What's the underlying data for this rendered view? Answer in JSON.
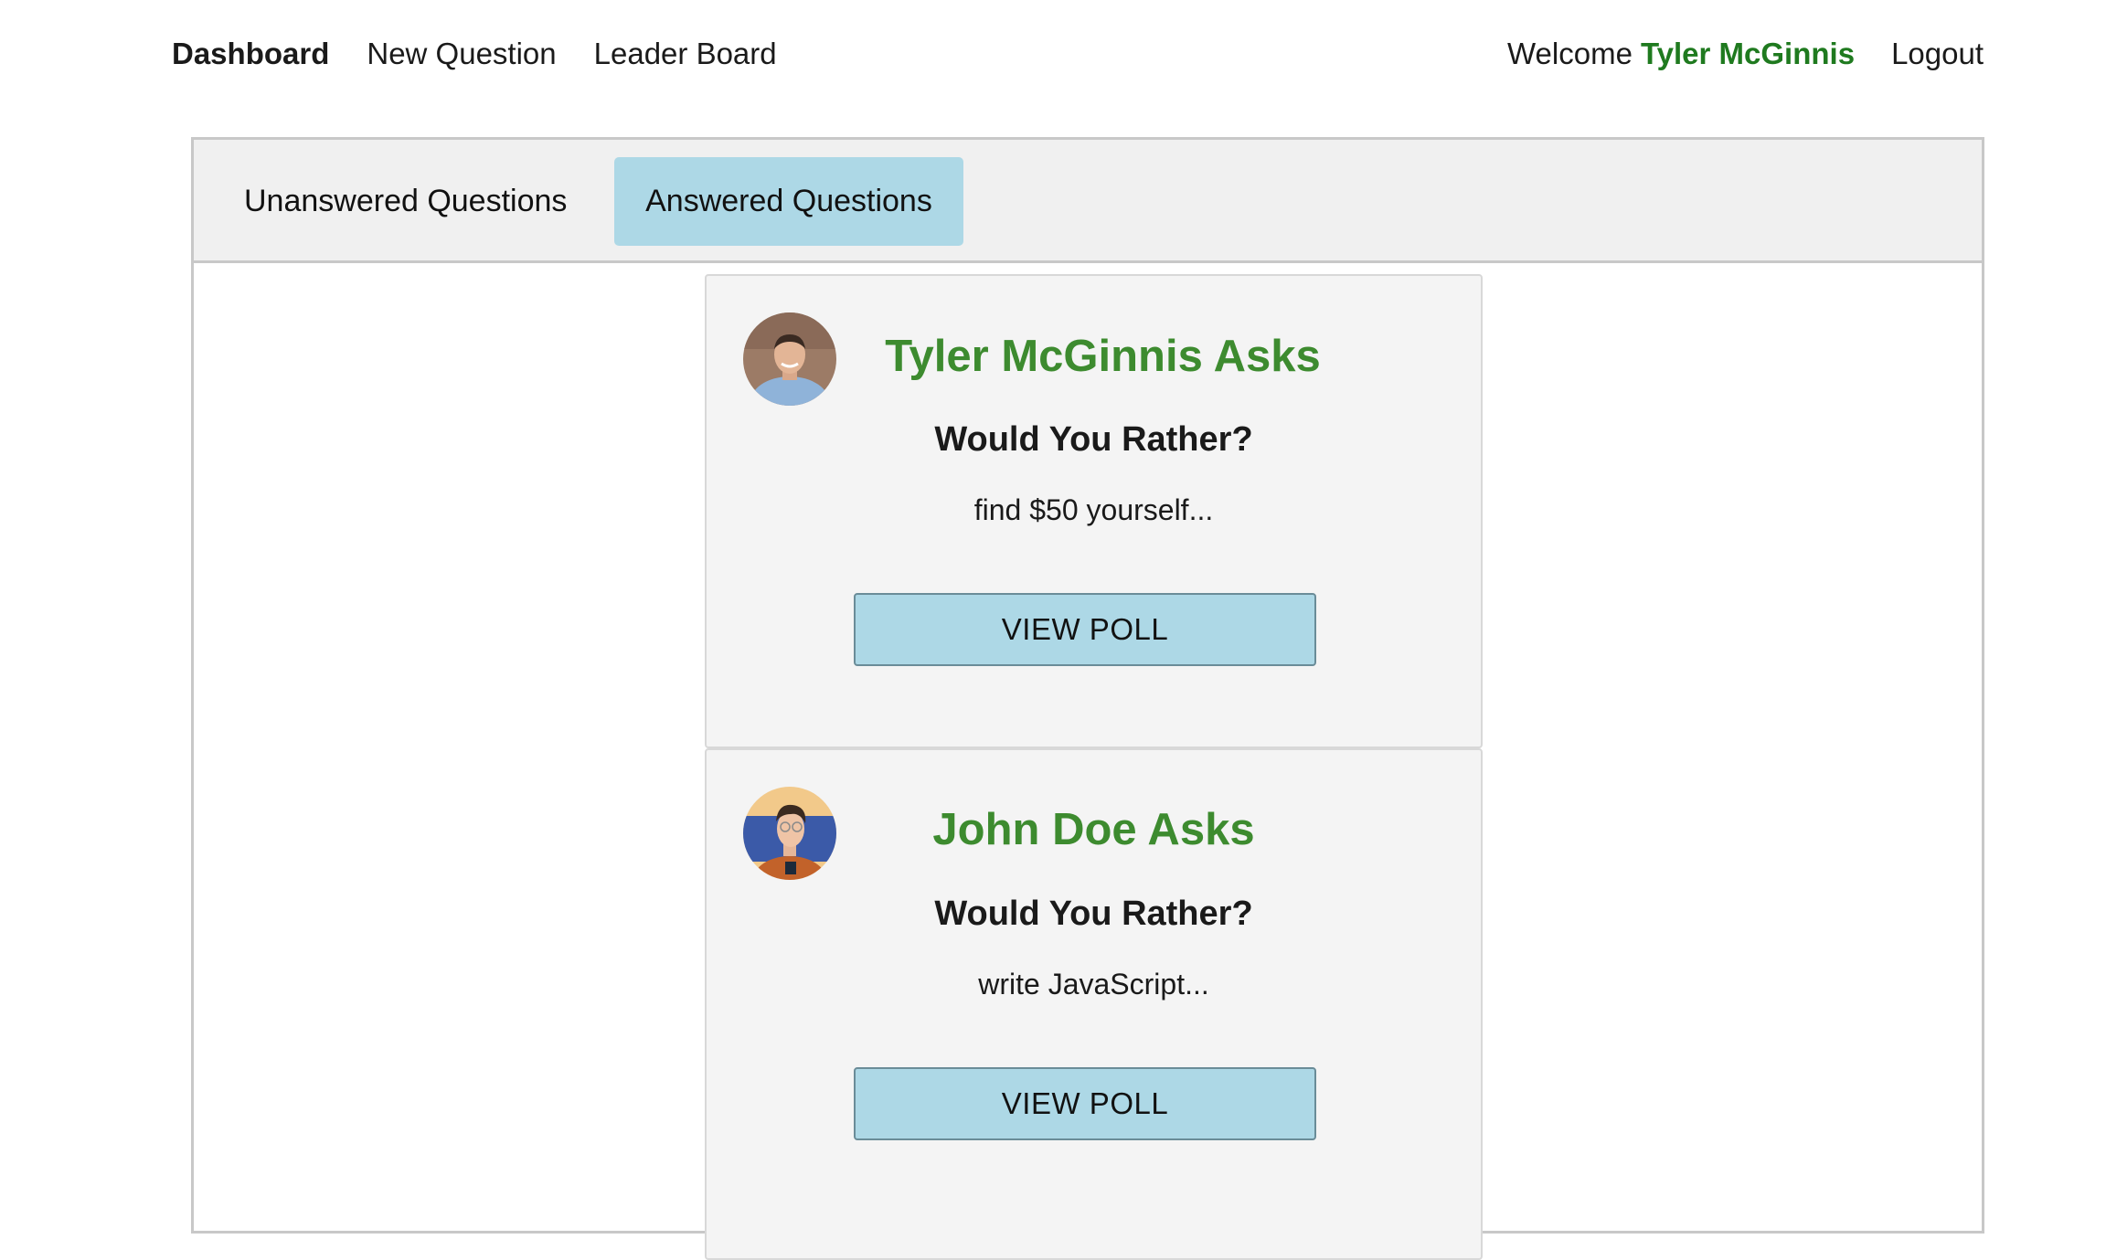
{
  "colors": {
    "accent_green": "#3d8b2f",
    "welcome_green": "#1f7a1f",
    "tab_active_bg": "#add8e6",
    "button_bg": "#add8e6"
  },
  "nav": {
    "links": [
      {
        "label": "Dashboard"
      },
      {
        "label": "New Question"
      },
      {
        "label": "Leader Board"
      }
    ],
    "welcome_prefix": "Welcome",
    "user_name": "Tyler McGinnis",
    "logout_label": "Logout"
  },
  "tabs": [
    {
      "label": "Unanswered Questions"
    },
    {
      "label": "Answered Questions"
    }
  ],
  "questions": [
    {
      "author_title": "Tyler McGinnis Asks",
      "subtitle": "Would You Rather?",
      "option_preview": "find $50 yourself...",
      "button_label": "VIEW POLL",
      "avatar_icon": "avatar-tyler"
    },
    {
      "author_title": "John Doe Asks",
      "subtitle": "Would You Rather?",
      "option_preview": "write JavaScript...",
      "button_label": "VIEW POLL",
      "avatar_icon": "avatar-john"
    }
  ]
}
